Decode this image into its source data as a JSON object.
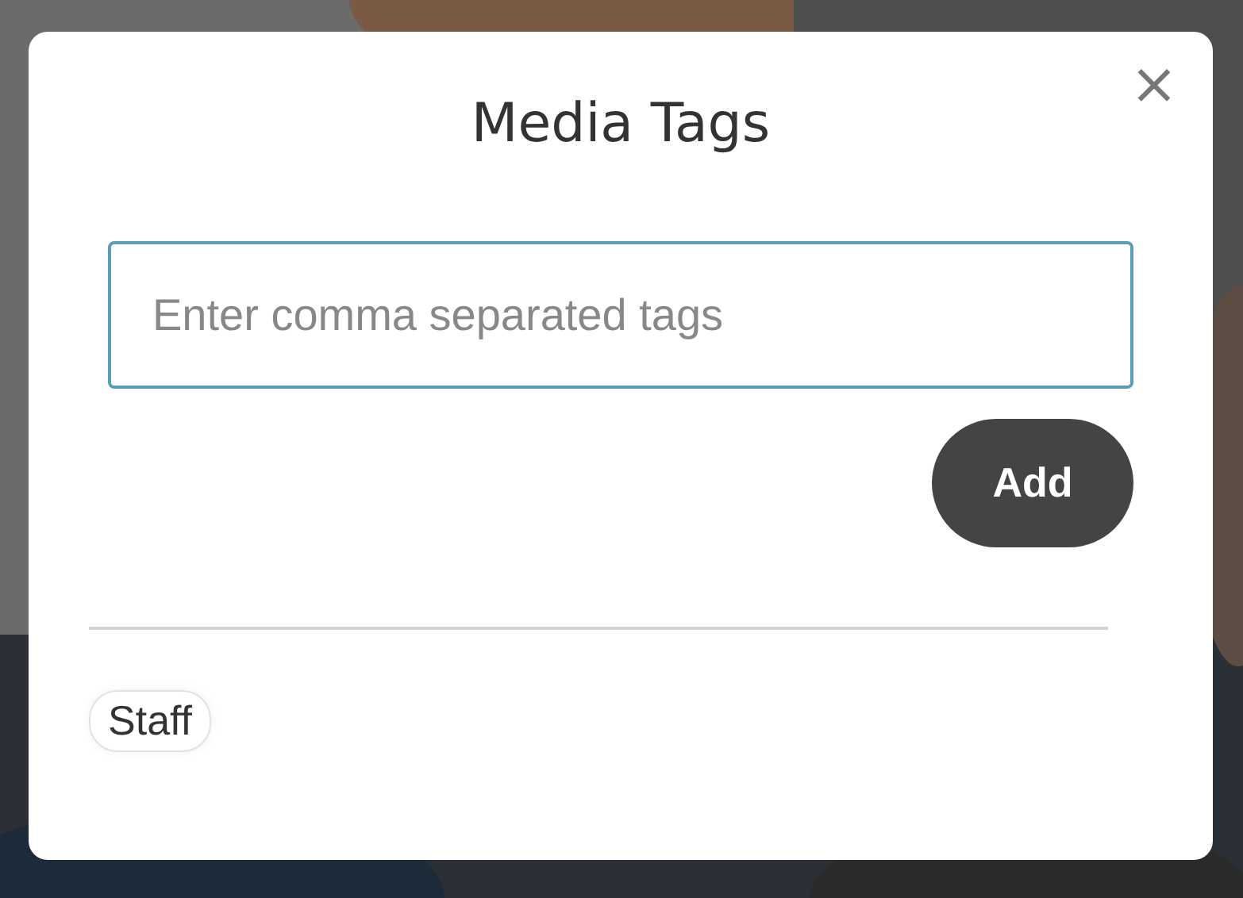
{
  "dialog": {
    "title": "Media Tags",
    "close": "×",
    "tag_input": {
      "placeholder": "Enter comma separated tags"
    },
    "add_button": "Add",
    "tags": [
      {
        "label": "Staff"
      }
    ]
  }
}
